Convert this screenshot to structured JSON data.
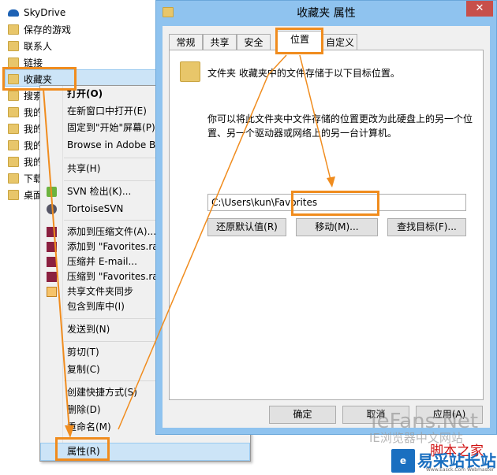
{
  "tree": {
    "items": [
      "SkyDrive",
      "保存的游戏",
      "联系人",
      "链接",
      "收藏夹",
      "搜索",
      "我的视频",
      "我的图片",
      "我的文档",
      "我的音乐",
      "下载",
      "桌面"
    ]
  },
  "menu": {
    "items": [
      "打开(O)",
      "在新窗口中打开(E)",
      "固定到\"开始\"屏幕(P)",
      "Browse in Adobe B",
      "共享(H)",
      "SVN 检出(K)...",
      "TortoiseSVN",
      "添加到压缩文件(A)...",
      "添加到 \"Favorites.ra",
      "压缩并 E-mail...",
      "压缩到 \"Favorites.ra",
      "共享文件夹同步",
      "包含到库中(I)",
      "发送到(N)",
      "剪切(T)",
      "复制(C)",
      "创建快捷方式(S)",
      "删除(D)",
      "重命名(M)",
      "属性(R)"
    ]
  },
  "dialog": {
    "title": "收藏夹 属性",
    "close": "✕",
    "tabs": [
      "常规",
      "共享",
      "安全",
      "位置",
      "自定义"
    ],
    "info": "文件夹 收藏夹中的文件存储于以下目标位置。",
    "desc": "你可以将此文件夹中文件存储的位置更改为此硬盘上的另一个位置、另一个驱动器或网络上的另一台计算机。",
    "path": "C:\\Users\\kun\\Favorites",
    "restore": "还原默认值(R)",
    "move": "移动(M)...",
    "find": "查找目标(F)...",
    "ok": "确定",
    "cancel": "取消",
    "apply": "应用(A)"
  },
  "watermark": {
    "line1": "IeFans.Net",
    "line2": "IE浏览器中文网站",
    "line3": "脚本之家",
    "logo": "易采站长站",
    "logo_sub": "Www.Easck.Com Webmaster"
  },
  "colors": {
    "highlight": "#f08c1e",
    "accent": "#8fc3ef"
  }
}
